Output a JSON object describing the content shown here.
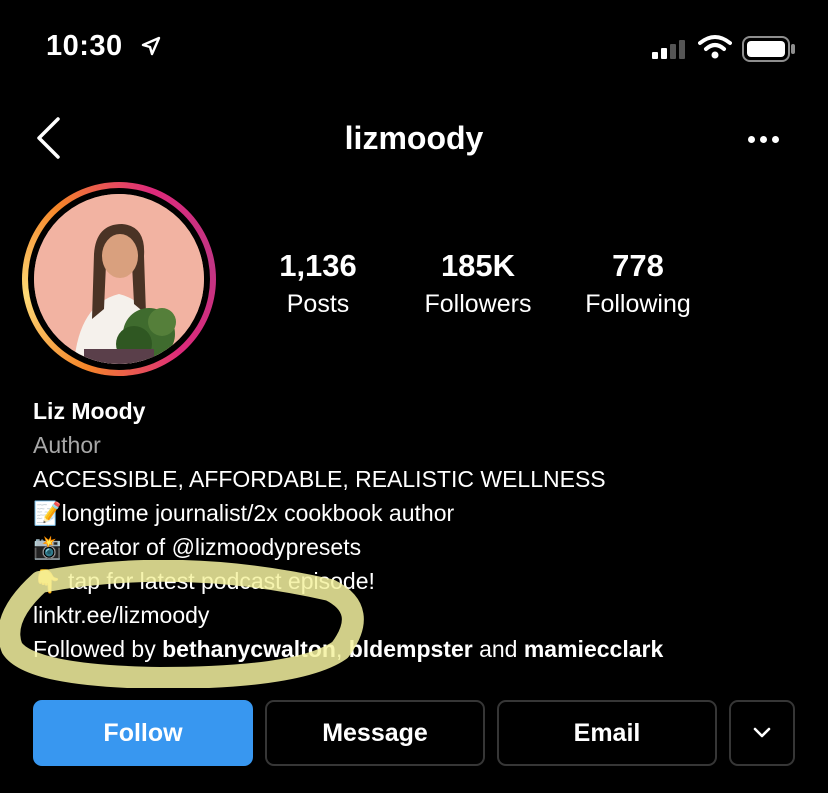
{
  "status_bar": {
    "time": "10:30"
  },
  "header": {
    "username": "lizmoody"
  },
  "stats": [
    {
      "value": "1,136",
      "label": "Posts"
    },
    {
      "value": "185K",
      "label": "Followers"
    },
    {
      "value": "778",
      "label": "Following"
    }
  ],
  "bio": {
    "name": "Liz Moody",
    "category": "Author",
    "line1": "ACCESSIBLE, AFFORDABLE, REALISTIC WELLNESS",
    "line2_emoji": "📝",
    "line2": "longtime journalist/2x cookbook author",
    "line3_emoji": "📸",
    "line3": " creator of @lizmoodypresets",
    "line4_emoji": "👇",
    "line4": " tap for latest podcast episode!",
    "link": "linktr.ee/lizmoody",
    "followed_prefix": "Followed by ",
    "followed_user1": "bethanycwalton",
    "followed_sep": ", ",
    "followed_user2": "bldempster",
    "followed_and": " and ",
    "followed_user3": "mamiecclark"
  },
  "actions": {
    "follow": "Follow",
    "message": "Message",
    "email": "Email"
  },
  "colors": {
    "follow_button": "#3897f0",
    "annotation_highlight": "#f4f2a0"
  }
}
